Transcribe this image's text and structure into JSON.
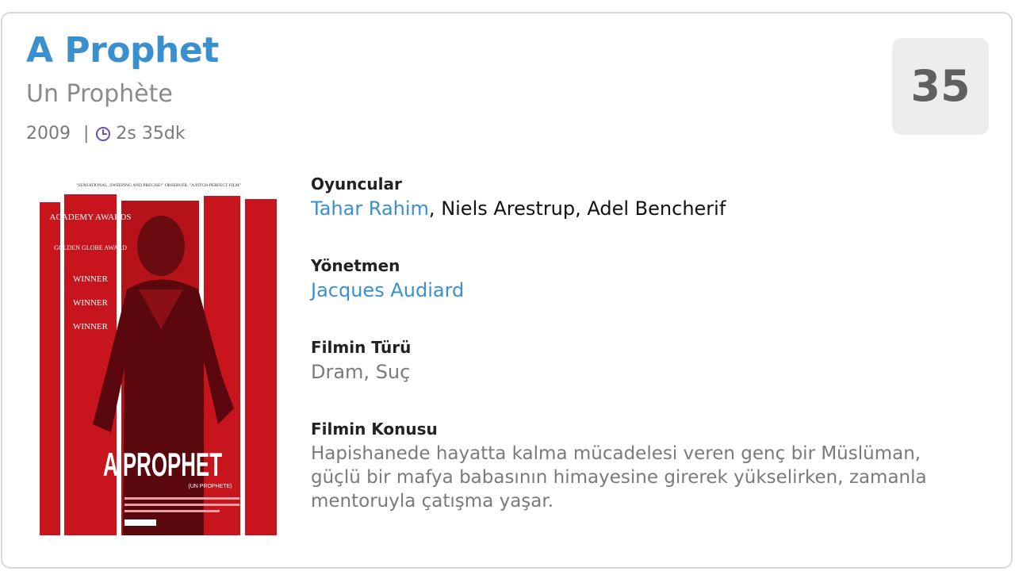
{
  "movie": {
    "title": "A Prophet",
    "original_title": "Un Prophète",
    "year": "2009",
    "separator": "|",
    "duration": "2s 35dk",
    "score": "35"
  },
  "icons": {
    "clock": "clock-icon"
  },
  "colors": {
    "accent": "#3a8fce",
    "poster_red": "#c8151d"
  },
  "poster": {
    "tagline": "\"SENSATIONAL, SWEEPING AND PRECISE!\" OBSERVER. \"A PITCH-PERFECT FILM\"",
    "laurels": [
      "ACADEMY AWARDS",
      "GOLDEN GLOBE AWARD",
      "WINNER",
      "WINNER",
      "WINNER"
    ],
    "title": "A PROPHET",
    "subtitle": "(UN PROPHETE)"
  },
  "details": {
    "cast_label": "Oyuncular",
    "cast": [
      {
        "name": "Tahar Rahim",
        "linked": true
      },
      {
        "name": "Niels Arestrup",
        "linked": false
      },
      {
        "name": "Adel Bencherif",
        "linked": false
      }
    ],
    "cast_separator": ", ",
    "director_label": "Yönetmen",
    "director": "Jacques Audiard",
    "genre_label": "Filmin Türü",
    "genre": "Dram, Suç",
    "plot_label": "Filmin Konusu",
    "plot": "Hapishanede hayatta kalma mücadelesi veren genç bir Müslüman, güçlü bir mafya babasının himayesine girerek yükselirken, zamanla mentoruyla çatışma yaşar."
  }
}
